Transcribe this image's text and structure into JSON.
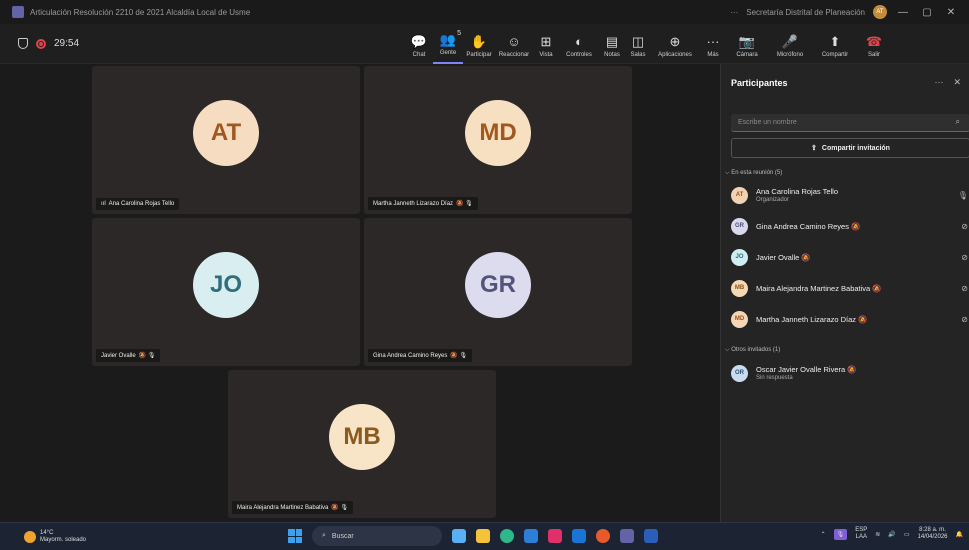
{
  "window": {
    "title": "Articulación Resolución 2210 de 2021 Alcaldía Local de Usme",
    "org": "Secretaría Distrital de Planeación",
    "user_initials": "AT",
    "more": "···",
    "minimize": "—",
    "restore": "▢",
    "close": "✕"
  },
  "meeting": {
    "timer": "29:54"
  },
  "toolbar": [
    {
      "label": "Chat",
      "icon": "chat-icon",
      "glyph": "💬"
    },
    {
      "label": "Gente",
      "icon": "people-icon",
      "glyph": "👥",
      "badge": "5",
      "active": true
    },
    {
      "label": "Participar",
      "icon": "raise-hand-icon",
      "glyph": "✋"
    },
    {
      "label": "Reaccionar",
      "icon": "smile-icon",
      "glyph": "☺"
    },
    {
      "label": "Vista",
      "icon": "grid-icon",
      "glyph": "⊞"
    },
    {
      "label": "Controles",
      "icon": "controls-icon",
      "glyph": "◐"
    },
    {
      "label": "Notas",
      "icon": "notes-icon",
      "glyph": "▤"
    },
    {
      "label": "Salas",
      "icon": "rooms-icon",
      "glyph": "◫"
    },
    {
      "label": "Aplicaciones",
      "icon": "apps-icon",
      "glyph": "⊕"
    },
    {
      "label": "Más",
      "icon": "more-icon",
      "glyph": "···"
    },
    {
      "label": "Cámara",
      "icon": "camera-off-icon",
      "glyph": "📷"
    },
    {
      "label": "Micrófono",
      "icon": "microphone-icon",
      "glyph": "🎤"
    },
    {
      "label": "Compartir",
      "icon": "share-screen-icon",
      "glyph": "⬆"
    },
    {
      "label": "Salir",
      "icon": "hang-up-icon",
      "glyph": "☎"
    }
  ],
  "tiles": [
    {
      "initials": "AT",
      "name": "Ana Carolina Rojas Tello",
      "color": "#f6dcc0",
      "text_color": "#a0581e",
      "prefix": "ııl"
    },
    {
      "initials": "MD",
      "name": "Martha Janneth Lizarazo Díaz",
      "color": "#f7dfc2",
      "text_color": "#a0581e",
      "suffix": "🔕 🎙"
    },
    {
      "initials": "JO",
      "name": "Javier Ovalle",
      "color": "#d8eef0",
      "text_color": "#2f6f7c",
      "suffix": "🔕 🎙"
    },
    {
      "initials": "GR",
      "name": "Gina Andrea Camino Reyes",
      "color": "#dcdcee",
      "text_color": "#54547a",
      "suffix": "🔕 🎙"
    },
    {
      "initials": "MB",
      "name": "Maira Alejandra Martinez Babativa",
      "color": "#f8e4c6",
      "text_color": "#8a5a1e",
      "suffix": "🔕 🎙"
    }
  ],
  "panel": {
    "title": "Participantes",
    "search_placeholder": "Escribe un nombre",
    "share_label": "Compartir invitación",
    "in_meeting_label": "En esta reunión (5)",
    "others_label": "Otros invitados (1)",
    "in_meeting": [
      {
        "initials": "AT",
        "name": "Ana Carolina Rojas Tello",
        "sub": "Organizador",
        "bg": "#f3d2b3",
        "fg": "#9c541a"
      },
      {
        "initials": "GR",
        "name": "Gina Andrea Camino Reyes 🔕",
        "sub": "",
        "bg": "#d9d9ee",
        "fg": "#4e4e78"
      },
      {
        "initials": "JO",
        "name": "Javier Ovalle 🔕",
        "sub": "",
        "bg": "#cfeef2",
        "fg": "#2d6c79"
      },
      {
        "initials": "MB",
        "name": "Maira Alejandra Martinez Babativa 🔕",
        "sub": "",
        "bg": "#f5d9b2",
        "fg": "#8a561c"
      },
      {
        "initials": "MD",
        "name": "Martha Janneth Lizarazo Díaz 🔕",
        "sub": "",
        "bg": "#f6d5b4",
        "fg": "#9c541a"
      }
    ],
    "others": [
      {
        "initials": "OR",
        "name": "Oscar Javier Ovalle Rivera 🔕",
        "sub": "Sin respuesta",
        "bg": "#c9dcef",
        "fg": "#2d4f79"
      }
    ]
  },
  "taskbar": {
    "temp": "14°C",
    "weather": "Mayorm. soleado",
    "search": "Buscar",
    "lang1": "ESP",
    "lang2": "LAA",
    "time": "8:28 a. m.",
    "date": "14/04/2026"
  }
}
